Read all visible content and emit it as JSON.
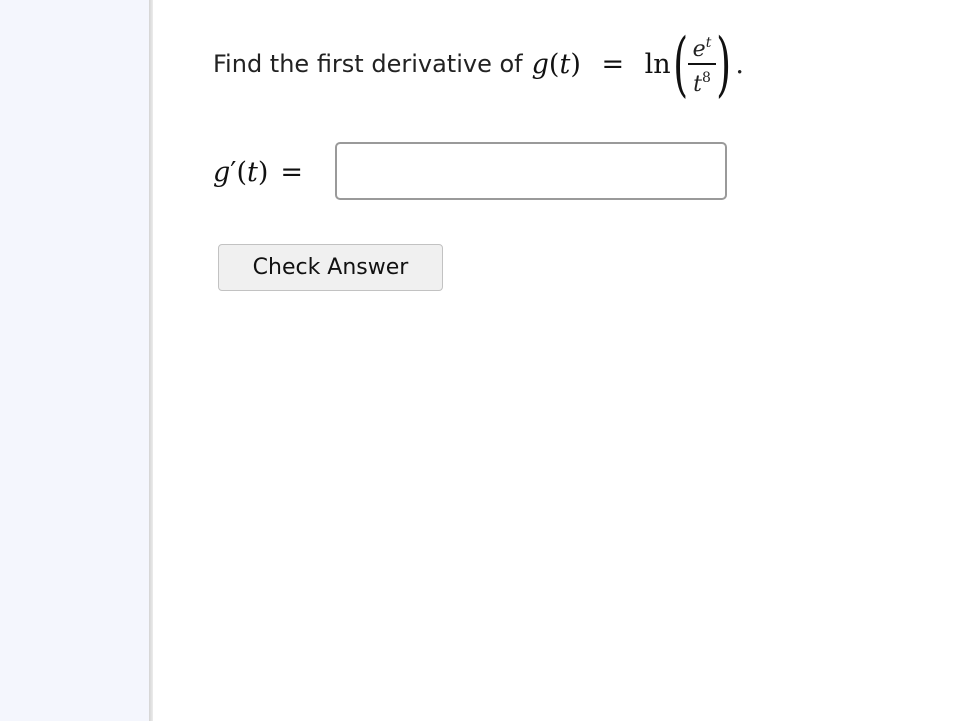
{
  "question": {
    "prompt_text": "Find the first derivative of",
    "function_name": "g",
    "variable": "t",
    "equals": "=",
    "log_function": "ln",
    "numerator_base": "e",
    "numerator_exponent": "t",
    "denominator_base": "t",
    "denominator_exponent": "8",
    "trailing_period": "."
  },
  "answer": {
    "label_function": "g",
    "label_prime": "′",
    "label_variable": "t",
    "equals": "=",
    "input_value": "",
    "input_placeholder": ""
  },
  "actions": {
    "check_answer_label": "Check Answer"
  }
}
